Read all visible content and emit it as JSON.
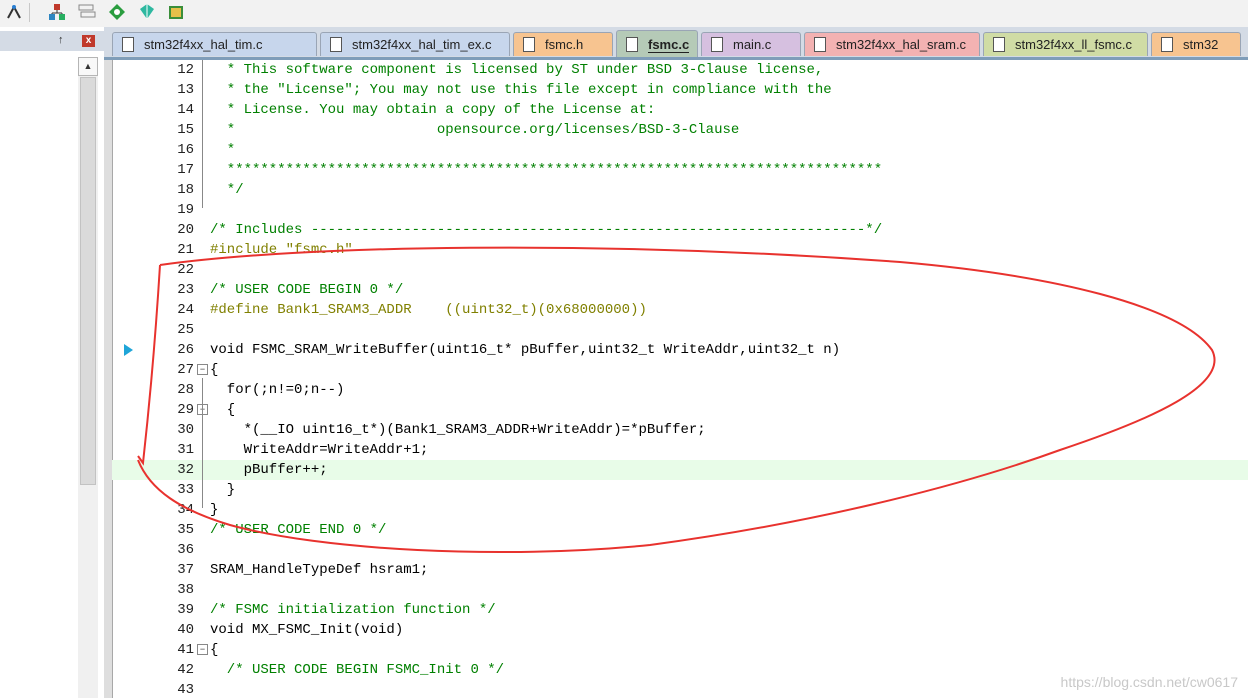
{
  "toolbar": {
    "buttons": [
      {
        "name": "wizard-icon"
      },
      {
        "name": "project-tree-icon"
      },
      {
        "name": "window-layout-icon"
      },
      {
        "name": "diamond-icon"
      },
      {
        "name": "tag-icon"
      },
      {
        "name": "package-icon"
      }
    ]
  },
  "left_panel": {
    "pin": "↑",
    "close": "x"
  },
  "tabs": [
    {
      "label": "stm32f4xx_hal_tim.c",
      "color": "#c7d6ec",
      "active": false
    },
    {
      "label": "stm32f4xx_hal_tim_ex.c",
      "color": "#c7d6ec",
      "active": false
    },
    {
      "label": "fsmc.h",
      "color": "#f7c490",
      "active": false
    },
    {
      "label": "fsmc.c",
      "color": "#b5cab7",
      "active": true
    },
    {
      "label": "main.c",
      "color": "#d6c0e0",
      "active": false
    },
    {
      "label": "stm32f4xx_hal_sram.c",
      "color": "#f3b2b2",
      "active": false
    },
    {
      "label": "stm32f4xx_ll_fsmc.c",
      "color": "#d0dca5",
      "active": false
    },
    {
      "label": "stm32",
      "color": "#f7c490",
      "active": false
    }
  ],
  "editor": {
    "lines": [
      {
        "n": "12",
        "text": "  * This software component is licensed by ST under BSD 3-Clause license,",
        "cls": "c-com"
      },
      {
        "n": "13",
        "text": "  * the \"License\"; You may not use this file except in compliance with the",
        "cls": "c-com"
      },
      {
        "n": "14",
        "text": "  * License. You may obtain a copy of the License at:",
        "cls": "c-com"
      },
      {
        "n": "15",
        "text": "  *                        opensource.org/licenses/BSD-3-Clause",
        "cls": "c-com"
      },
      {
        "n": "16",
        "text": "  *",
        "cls": "c-com"
      },
      {
        "n": "17",
        "text": "  ******************************************************************************",
        "cls": "c-com"
      },
      {
        "n": "18",
        "text": "  */",
        "cls": "c-com"
      },
      {
        "n": "19",
        "text": "",
        "cls": ""
      },
      {
        "n": "20",
        "text": "/* Includes ------------------------------------------------------------------*/",
        "cls": "c-com"
      },
      {
        "n": "21",
        "text": "#include \"fsmc.h\"",
        "cls": "c-pre"
      },
      {
        "n": "22",
        "text": "",
        "cls": ""
      },
      {
        "n": "23",
        "text": "/* USER CODE BEGIN 0 */",
        "cls": "c-com"
      },
      {
        "n": "24",
        "text": "#define Bank1_SRAM3_ADDR    ((uint32_t)(0x68000000))",
        "cls": "c-pre"
      },
      {
        "n": "25",
        "text": "",
        "cls": ""
      },
      {
        "n": "26",
        "text": "void FSMC_SRAM_WriteBuffer(uint16_t* pBuffer,uint32_t WriteAddr,uint32_t n)",
        "cls": ""
      },
      {
        "n": "27",
        "text": "{",
        "cls": ""
      },
      {
        "n": "28",
        "text": "  for(;n!=0;n--)",
        "cls": ""
      },
      {
        "n": "29",
        "text": "  {",
        "cls": ""
      },
      {
        "n": "30",
        "text": "    *(__IO uint16_t*)(Bank1_SRAM3_ADDR+WriteAddr)=*pBuffer;",
        "cls": ""
      },
      {
        "n": "31",
        "text": "    WriteAddr=WriteAddr+1;",
        "cls": ""
      },
      {
        "n": "32",
        "text": "    pBuffer++;",
        "cls": ""
      },
      {
        "n": "33",
        "text": "  }",
        "cls": ""
      },
      {
        "n": "34",
        "text": "}",
        "cls": ""
      },
      {
        "n": "35",
        "text": "/* USER CODE END 0 */",
        "cls": "c-com"
      },
      {
        "n": "36",
        "text": "",
        "cls": ""
      },
      {
        "n": "37",
        "text": "SRAM_HandleTypeDef hsram1;",
        "cls": ""
      },
      {
        "n": "38",
        "text": "",
        "cls": ""
      },
      {
        "n": "39",
        "text": "/* FSMC initialization function */",
        "cls": "c-com"
      },
      {
        "n": "40",
        "text": "void MX_FSMC_Init(void)",
        "cls": ""
      },
      {
        "n": "41",
        "text": "{",
        "cls": ""
      },
      {
        "n": "42",
        "text": "  /* USER CODE BEGIN FSMC_Init 0 */",
        "cls": "c-com"
      },
      {
        "n": "43",
        "text": "",
        "cls": ""
      }
    ],
    "highlighted_line": "32",
    "current_line_marker": "26"
  },
  "watermark": "https://blog.csdn.net/cw0617"
}
